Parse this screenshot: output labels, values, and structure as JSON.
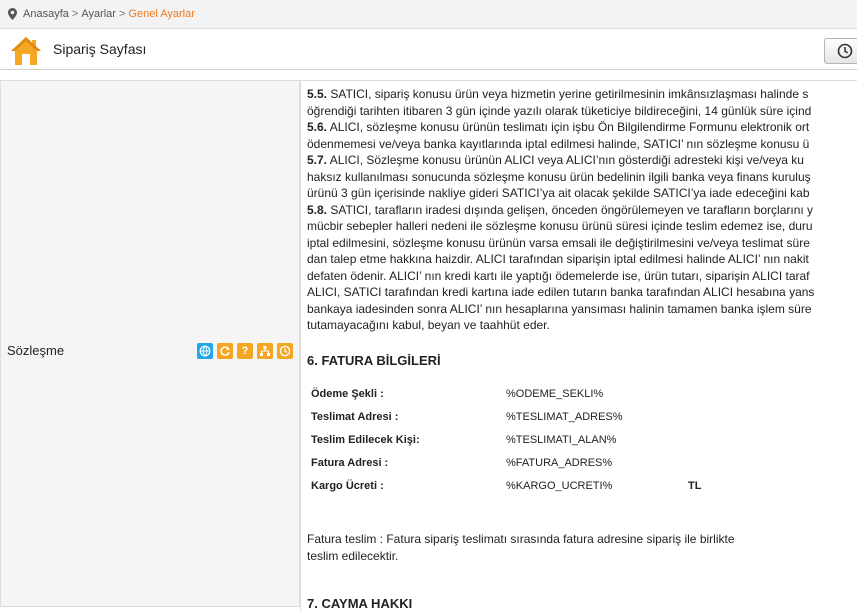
{
  "breadcrumb": {
    "home": "Anasayfa",
    "settings": "Ayarlar",
    "current": "Genel Ayarlar",
    "separator": ">"
  },
  "header": {
    "title": "Sipariş Sayfası"
  },
  "field": {
    "label": "Sözleşme",
    "tools": [
      "globe-icon",
      "refresh-icon",
      "help-icon",
      "tree-icon",
      "clock-icon"
    ],
    "help_glyph": "?"
  },
  "contract": {
    "lines": [
      {
        "num": "5.5.",
        "text": " SATICI, sipariş konusu ürün veya hizmetin yerine getirilmesinin imkânsızlaşması halinde s"
      },
      {
        "num": "",
        "text": "öğrendiği tarihten itibaren 3 gün içinde yazılı olarak tüketiciye bildireceğini, 14 günlük süre içind"
      },
      {
        "num": "5.6.",
        "text": " ALICI, sözleşme konusu ürünün teslimatı için işbu Ön Bilgilendirme Formunu elektronik ort"
      },
      {
        "num": "",
        "text": "ödenmemesi ve/veya banka kayıtlarında iptal edilmesi halinde, SATICI’ nın sözleşme konusu ü"
      },
      {
        "num": "5.7.",
        "text": " ALICI, Sözleşme konusu ürünün ALICI veya ALICI’nın gösterdiği adresteki kişi ve/veya ku"
      },
      {
        "num": "",
        "text": "haksız kullanılması sonucunda sözleşme konusu ürün bedelinin ilgili banka veya finans kuruluş"
      },
      {
        "num": "",
        "text": "ürünü 3 gün içerisinde nakliye gideri SATICI’ya ait olacak şekilde SATICI’ya iade edeceğini kab"
      },
      {
        "num": "5.8.",
        "text": " SATICI, tarafların iradesi dışında gelişen, önceden öngörülemeyen ve tarafların borçlarını y"
      },
      {
        "num": "",
        "text": "mücbir sebepler halleri nedeni ile sözleşme konusu ürünü süresi içinde teslim edemez ise, duru"
      },
      {
        "num": "",
        "text": "iptal edilmesini, sözleşme konusu ürünün varsa emsali ile değiştirilmesini ve/veya teslimat süre"
      },
      {
        "num": "",
        "text": "dan talep etme hakkına haizdir. ALICI tarafından siparişin iptal edilmesi halinde ALICI’ nın nakit"
      },
      {
        "num": "",
        "text": "defaten ödenir. ALICI’ nın kredi kartı ile yaptığı ödemelerde ise, ürün tutarı, siparişin ALICI taraf"
      },
      {
        "num": "",
        "text": "ALICI, SATICI tarafından kredi kartına iade edilen tutarın banka tarafından ALICI hesabına yans"
      },
      {
        "num": "",
        "text": "bankaya iadesinden sonra ALICI’ nın hesaplarına yansıması halinin tamamen banka işlem süre"
      },
      {
        "num": "",
        "text": "tutamayacağını kabul, beyan ve taahhüt eder."
      }
    ],
    "section6_title": "6. FATURA BİLGİLERİ",
    "invoice": [
      {
        "label": "Ödeme Şekli :",
        "value": "%ODEME_SEKLI%"
      },
      {
        "label": "Teslimat Adresi :",
        "value": "%TESLIMAT_ADRES%"
      },
      {
        "label": "Teslim Edilecek Kişi:",
        "value": "%TESLIMATI_ALAN%"
      },
      {
        "label": "Fatura Adresi :",
        "value": "%FATURA_ADRES%"
      },
      {
        "label": "Kargo Ücreti :",
        "value": "%KARGO_UCRETI%",
        "unit": "TL"
      }
    ],
    "note_line1": "Fatura teslim : Fatura sipariş teslimatı sırasında fatura adresine sipariş ile birlikte",
    "note_line2": "teslim edilecektir.",
    "section7_title": "7. CAYMA HAKKI"
  },
  "colors": {
    "accent": "#ec7a22",
    "tool_blue": "#22a6e6",
    "tool_orange": "#f5a623"
  }
}
